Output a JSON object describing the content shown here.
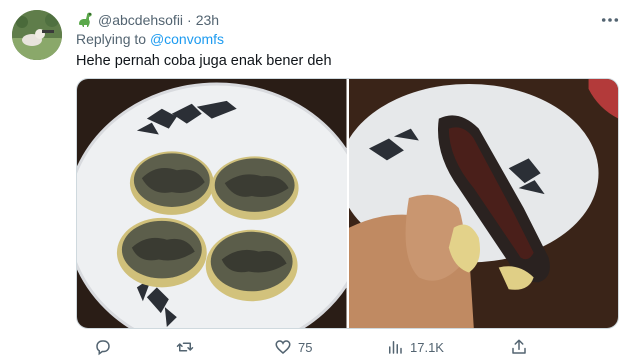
{
  "tweet": {
    "handle": "@abcdehsofii",
    "separator": "·",
    "time": "23h",
    "replying_prefix": "Replying to ",
    "replying_to": "@convomfs",
    "text": "Hehe pernah coba juga enak bener deh",
    "more_icon": "more-horizontal-icon",
    "badge_icon": "dinosaur-emoji-icon"
  },
  "media": {
    "images": [
      {
        "name": "photo-fried-snacks-plate"
      },
      {
        "name": "photo-fried-snack-in-hand"
      }
    ]
  },
  "actions": {
    "reply": {
      "icon": "reply-icon",
      "count": ""
    },
    "retweet": {
      "icon": "retweet-icon",
      "count": ""
    },
    "like": {
      "icon": "heart-icon",
      "count": "75"
    },
    "views": {
      "icon": "views-icon",
      "count": "17.1K"
    },
    "share": {
      "icon": "share-icon",
      "count": ""
    }
  },
  "colors": {
    "accent": "#1d9bf0",
    "secondary_text": "#536471",
    "primary_text": "#0f1419"
  }
}
